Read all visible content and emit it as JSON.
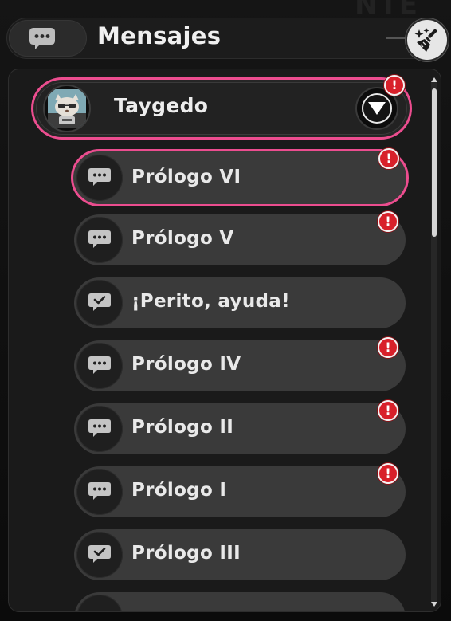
{
  "header": {
    "title": "Mensajes",
    "chat_icon": "chat-bubble-icon",
    "clean_icon": "broom-sparkle-icon"
  },
  "contact": {
    "name": "Taygedo",
    "avatar_icon": "character-avatar",
    "expand_icon": "triangle-down-icon",
    "badge": "!"
  },
  "messages": [
    {
      "label": "Prólogo VI",
      "icon": "chat-dots-icon",
      "badge": "!",
      "selected": true
    },
    {
      "label": "Prólogo V",
      "icon": "chat-dots-icon",
      "badge": "!"
    },
    {
      "label": "¡Perito, ayuda!",
      "icon": "chat-check-icon",
      "badge": ""
    },
    {
      "label": "Prólogo IV",
      "icon": "chat-dots-icon",
      "badge": "!"
    },
    {
      "label": "Prólogo II",
      "icon": "chat-dots-icon",
      "badge": "!"
    },
    {
      "label": "Prólogo I",
      "icon": "chat-dots-icon",
      "badge": "!"
    },
    {
      "label": "Prólogo III",
      "icon": "chat-check-icon",
      "badge": ""
    }
  ],
  "colors": {
    "accent": "#ec4d8f",
    "alert": "#d8202a",
    "row_bg": "#3a3a3a"
  }
}
